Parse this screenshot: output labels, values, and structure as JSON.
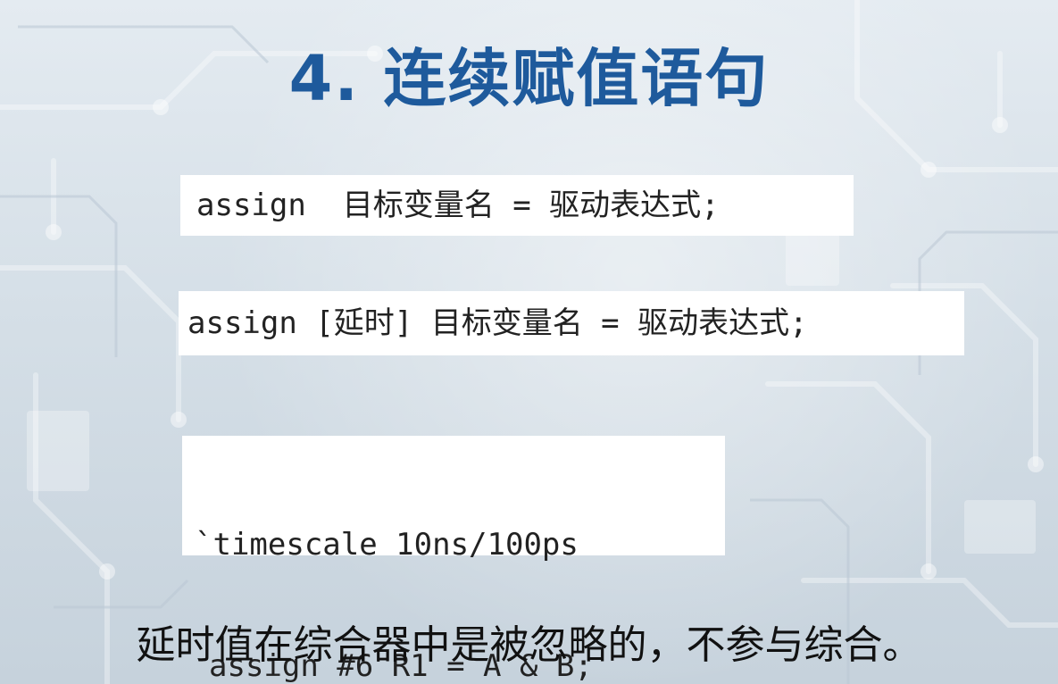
{
  "title": "4. 连续赋值语句",
  "syntax_basic": "assign  目标变量名 = 驱动表达式;",
  "syntax_delay": "assign [延时] 目标变量名 = 驱动表达式;",
  "example": {
    "line1": "`timescale 10ns/100ps",
    "line2": "assign #6 R1 = A & B;"
  },
  "note": "延时值在综合器中是被忽略的，不参与综合。",
  "colors": {
    "title": "#1e5a9c",
    "code_background": "#ffffff",
    "code_text": "#222222",
    "note_text": "#111111"
  },
  "background": "circuit-board-pattern"
}
